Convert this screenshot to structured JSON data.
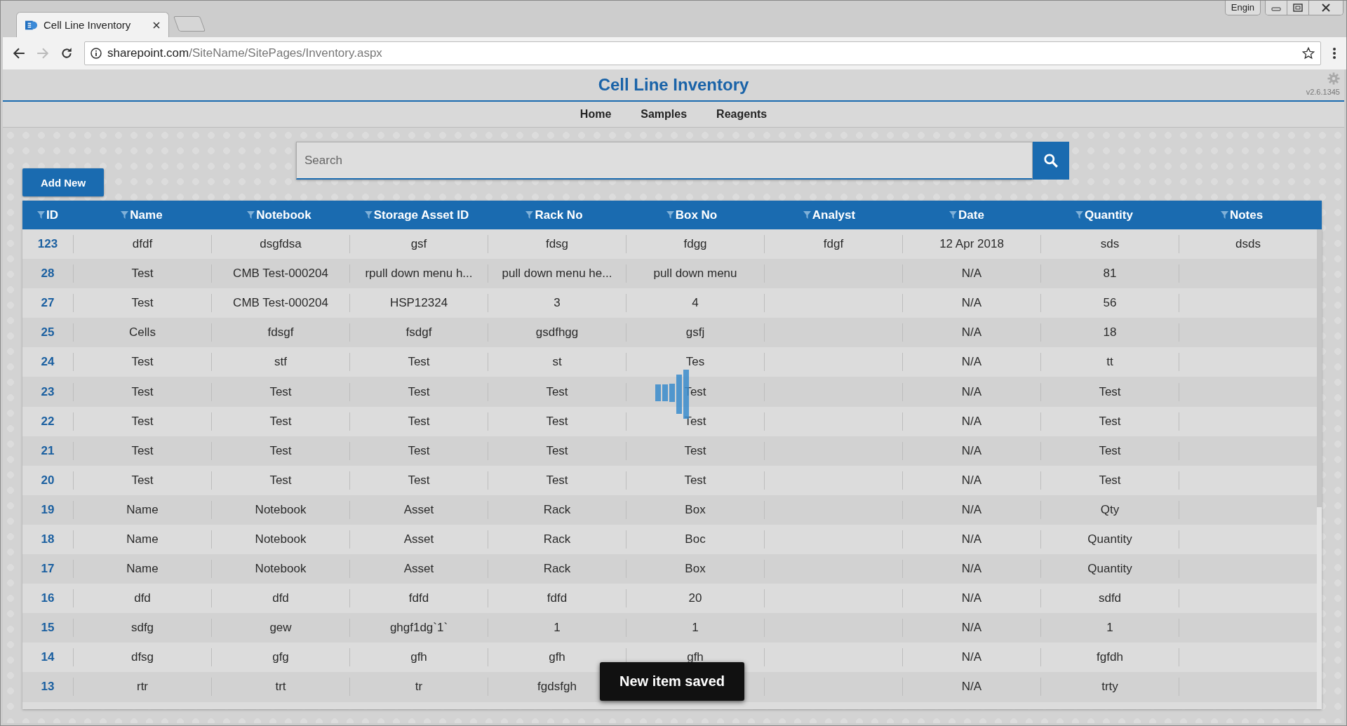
{
  "browser": {
    "tab_title": "Cell Line Inventory",
    "language_indicator": "Engin",
    "address": {
      "host": "sharepoint.com",
      "path": "/SiteName/SitePages/Inventory.aspx"
    }
  },
  "header": {
    "title": "Cell Line Inventory",
    "version": "v2.6.1345"
  },
  "nav": [
    {
      "label": "Home"
    },
    {
      "label": "Samples"
    },
    {
      "label": "Reagents"
    }
  ],
  "search": {
    "placeholder": "Search"
  },
  "add_button": "Add New",
  "table": {
    "columns": [
      "ID",
      "Name",
      "Notebook",
      "Storage Asset ID",
      "Rack No",
      "Box No",
      "Analyst",
      "Date",
      "Quantity",
      "Notes"
    ],
    "rows": [
      [
        "123",
        "dfdf",
        "dsgfdsa",
        "gsf",
        "fdsg",
        "fdgg",
        "fdgf",
        "12 Apr 2018",
        "sds",
        "dsds"
      ],
      [
        "28",
        "Test",
        "CMB Test-000204",
        "rpull down menu h...",
        "pull down menu he...",
        "pull down menu",
        null,
        "N/A",
        "81",
        null
      ],
      [
        "27",
        "Test",
        "CMB Test-000204",
        "HSP12324",
        "3",
        "4",
        null,
        "N/A",
        "56",
        null
      ],
      [
        "25",
        "Cells",
        "fdsgf",
        "fsdgf",
        "gsdfhgg",
        "gsfj",
        null,
        "N/A",
        "18",
        null
      ],
      [
        "24",
        "Test",
        "stf",
        "Test",
        "st",
        "Tes",
        null,
        "N/A",
        "tt",
        null
      ],
      [
        "23",
        "Test",
        "Test",
        "Test",
        "Test",
        "Test",
        null,
        "N/A",
        "Test",
        null
      ],
      [
        "22",
        "Test",
        "Test",
        "Test",
        "Test",
        "Test",
        null,
        "N/A",
        "Test",
        null
      ],
      [
        "21",
        "Test",
        "Test",
        "Test",
        "Test",
        "Test",
        null,
        "N/A",
        "Test",
        null
      ],
      [
        "20",
        "Test",
        "Test",
        "Test",
        "Test",
        "Test",
        null,
        "N/A",
        "Test",
        null
      ],
      [
        "19",
        "Name",
        "Notebook",
        "Asset",
        "Rack",
        "Box",
        null,
        "N/A",
        "Qty",
        null
      ],
      [
        "18",
        "Name",
        "Notebook",
        "Asset",
        "Rack",
        "Boc",
        null,
        "N/A",
        "Quantity",
        null
      ],
      [
        "17",
        "Name",
        "Notebook",
        "Asset",
        "Rack",
        "Box",
        null,
        "N/A",
        "Quantity",
        null
      ],
      [
        "16",
        "dfd",
        "dfd",
        "fdfd",
        "fdfd",
        "20",
        null,
        "N/A",
        "sdfd",
        null
      ],
      [
        "15",
        "sdfg",
        "gew",
        "ghgf1dg`1`",
        "1",
        "1",
        null,
        "N/A",
        "1",
        null
      ],
      [
        "14",
        "dfsg",
        "gfg",
        "gfh",
        "gfh",
        "gfh",
        null,
        "N/A",
        "fgfdh",
        null
      ],
      [
        "13",
        "rtr",
        "trt",
        "tr",
        "fgdsfgh",
        null,
        null,
        "N/A",
        "trty",
        null
      ]
    ]
  },
  "toast": "New item saved",
  "loading": true
}
